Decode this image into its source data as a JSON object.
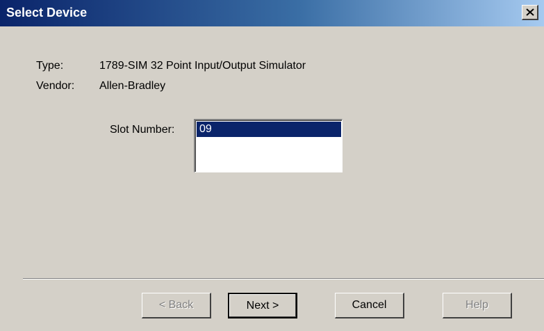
{
  "window": {
    "title": "Select Device",
    "close_glyph": "✕"
  },
  "device": {
    "type_label": "Type:",
    "type_value": "1789-SIM 32 Point Input/Output Simulator",
    "vendor_label": "Vendor:",
    "vendor_value": "Allen-Bradley"
  },
  "slot": {
    "label": "Slot Number:",
    "options": [
      "09"
    ],
    "selected": "09"
  },
  "buttons": {
    "back_label": "< Back",
    "next_label": "Next >",
    "cancel_label": "Cancel",
    "help_label": "Help"
  },
  "colors": {
    "titlebar_start": "#0a246a",
    "titlebar_end": "#a6caf0",
    "face": "#d4d0c8",
    "selection": "#0a246a"
  },
  "icons": {
    "close": "close-icon"
  }
}
